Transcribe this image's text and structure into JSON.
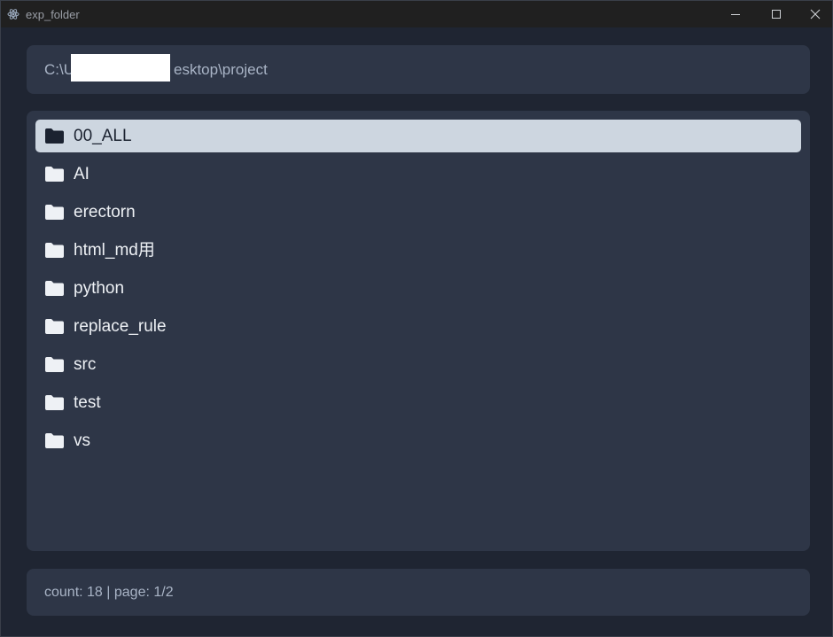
{
  "window": {
    "title": "exp_folder",
    "app_icon": "electron-icon",
    "controls": [
      "minimize-icon",
      "maximize-icon",
      "close-icon"
    ]
  },
  "path_bar": {
    "prefix": "C:\\U",
    "suffix": "esktop\\project"
  },
  "folders": [
    {
      "name": "00_ALL",
      "selected": true,
      "icon": "folder-icon"
    },
    {
      "name": "AI",
      "selected": false,
      "icon": "folder-icon"
    },
    {
      "name": "erectorn",
      "selected": false,
      "icon": "folder-icon"
    },
    {
      "name": "html_md用",
      "selected": false,
      "icon": "folder-icon"
    },
    {
      "name": "python",
      "selected": false,
      "icon": "folder-icon"
    },
    {
      "name": "replace_rule",
      "selected": false,
      "icon": "folder-icon"
    },
    {
      "name": "src",
      "selected": false,
      "icon": "folder-icon"
    },
    {
      "name": "test",
      "selected": false,
      "icon": "folder-icon"
    },
    {
      "name": "vs",
      "selected": false,
      "icon": "folder-icon"
    }
  ],
  "status": {
    "text": "count: 18 | page: 1/2"
  },
  "colors": {
    "background": "#1f2532",
    "panel": "#2e3647",
    "selected_row": "#cdd6e0",
    "text_primary": "#eef1f5",
    "text_muted": "#a9b4c6"
  }
}
